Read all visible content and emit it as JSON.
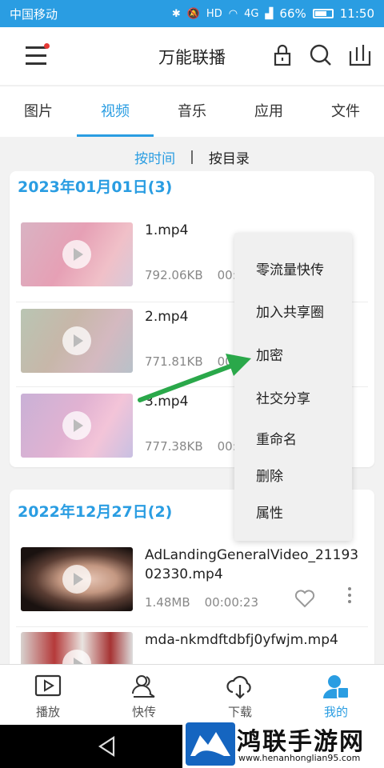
{
  "status_bar": {
    "carrier": "中国移动",
    "network": "4G",
    "battery": "66%",
    "time": "11:50"
  },
  "app": {
    "title": "万能联播"
  },
  "tabs": [
    {
      "label": "图片"
    },
    {
      "label": "视频",
      "active": true
    },
    {
      "label": "音乐"
    },
    {
      "label": "应用"
    },
    {
      "label": "文件"
    }
  ],
  "sort": {
    "by_time": "按时间",
    "separator": "|",
    "by_folder": "按目录"
  },
  "groups": [
    {
      "title": "2023年01月01日(3)",
      "items": [
        {
          "name": "1.mp4",
          "size": "792.06KB",
          "duration": "00:0"
        },
        {
          "name": "2.mp4",
          "size": "771.81KB",
          "duration": "00:0"
        },
        {
          "name": "3.mp4",
          "size": "777.38KB",
          "duration": "00:0"
        }
      ]
    },
    {
      "title": "2022年12月27日(2)",
      "items": [
        {
          "name": "AdLandingGeneralVideo_2119302330.mp4",
          "size": "1.48MB",
          "duration": "00:00:23"
        },
        {
          "name": "mda-nkmdftdbfj0yfwjm.mp4",
          "size": "",
          "duration": ""
        }
      ]
    }
  ],
  "context_menu": {
    "items": [
      "零流量快传",
      "加入共享圈",
      "加密",
      "社交分享",
      "重命名",
      "删除",
      "属性"
    ]
  },
  "bottom_nav": [
    {
      "label": "播放",
      "icon": "play-screen-icon"
    },
    {
      "label": "快传",
      "icon": "people-transfer-icon"
    },
    {
      "label": "下载",
      "icon": "cloud-download-icon"
    },
    {
      "label": "我的",
      "icon": "user-profile-icon",
      "active": true
    }
  ],
  "watermark": {
    "text": "鸿联手游网",
    "url": "www.henanhonglian95.com"
  },
  "colors": {
    "accent": "#2a9de2",
    "arrow": "#2aa84a"
  }
}
